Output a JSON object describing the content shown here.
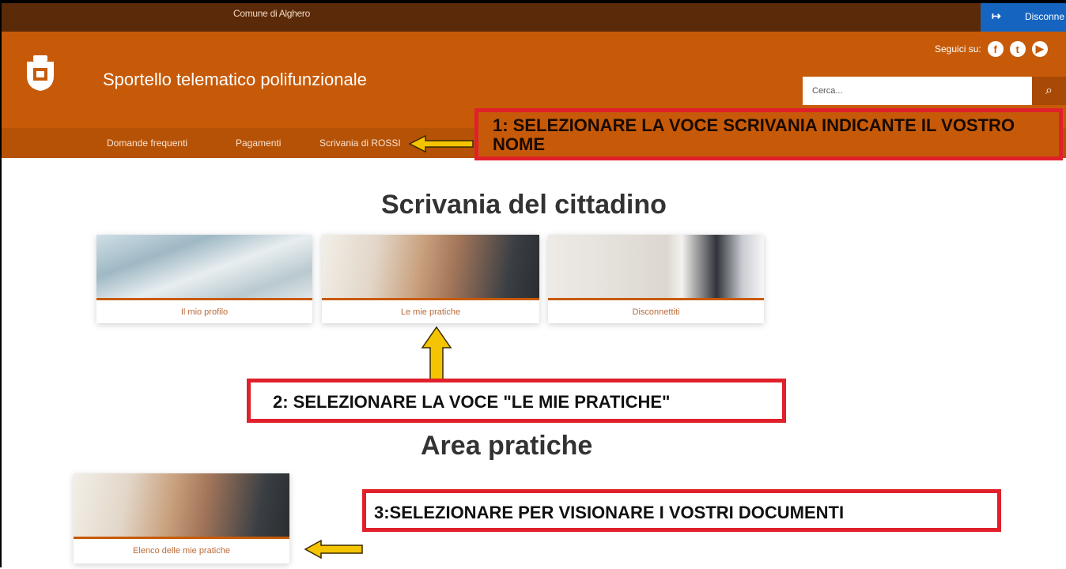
{
  "topbar": {
    "comune": "Comune di Alghero",
    "logout_label": "Disconne"
  },
  "header": {
    "site_title": "Sportello telematico polifunzionale",
    "social_label": "Seguici su:",
    "search_placeholder": "Cerca..."
  },
  "nav": {
    "items": [
      "Domande frequenti",
      "Pagamenti",
      "Scrivania di ROSSI"
    ]
  },
  "annotations": {
    "step1": "1: SELEZIONARE LA VOCE SCRIVANIA INDICANTE IL VOSTRO NOME",
    "step2": "2: SELEZIONARE LA VOCE \"LE MIE PRATICHE\"",
    "step3": "3:SELEZIONARE PER VISIONARE I VOSTRI DOCUMENTI"
  },
  "main": {
    "title": "Scrivania del cittadino",
    "cards": [
      "Il mio profilo",
      "Le mie pratiche",
      "Disconnettiti"
    ],
    "area_title": "Area pratiche",
    "area_cards": [
      "Elenco delle mie pratiche"
    ]
  },
  "colors": {
    "header": "#c75a08",
    "nav": "#b55206",
    "topbar": "#5b2a08",
    "annotation_border": "#e0202a",
    "arrow": "#f5c400"
  }
}
